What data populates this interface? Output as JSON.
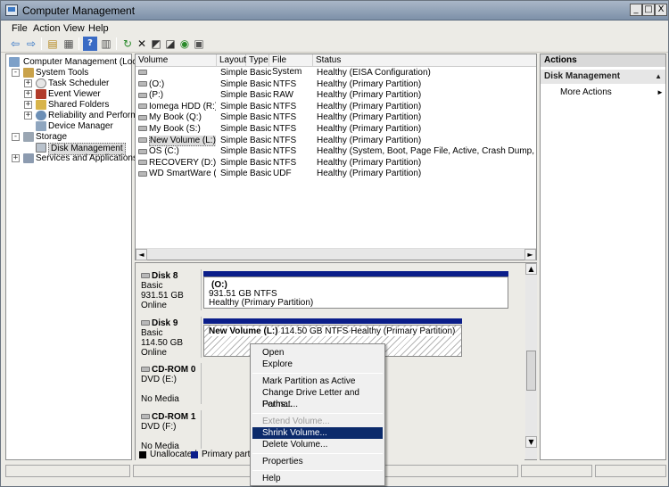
{
  "window": {
    "title": "Computer Management",
    "min": "_",
    "max": "□",
    "close": "X"
  },
  "menu": [
    "File",
    "Action",
    "View",
    "Help"
  ],
  "toolbar": {
    "icons": [
      "back-arrow-icon",
      "forward-arrow-icon",
      "up-folder-icon",
      "show-hide-tree-icon",
      "help-icon",
      "properties-icon",
      "refresh-icon",
      "delete-icon",
      "connect-icon",
      "rescan-icon",
      "settings-icon"
    ]
  },
  "tree": {
    "root": "Computer Management (Local)",
    "system_tools": "System Tools",
    "task_scheduler": "Task Scheduler",
    "event_viewer": "Event Viewer",
    "shared_folders": "Shared Folders",
    "reliability": "Reliability and Performanc",
    "device_manager": "Device Manager",
    "storage": "Storage",
    "disk_management": "Disk Management",
    "services": "Services and Applications"
  },
  "volumes": {
    "headers": [
      "Volume",
      "Layout",
      "Type",
      "File System",
      "Status"
    ],
    "rows": [
      {
        "volume": "",
        "layout": "Simple",
        "type": "Basic",
        "fs": "",
        "status": "Healthy (EISA Configuration)"
      },
      {
        "volume": "(O:)",
        "layout": "Simple",
        "type": "Basic",
        "fs": "NTFS",
        "status": "Healthy (Primary Partition)"
      },
      {
        "volume": "(P:)",
        "layout": "Simple",
        "type": "Basic",
        "fs": "RAW",
        "status": "Healthy (Primary Partition)"
      },
      {
        "volume": "Iomega HDD (R:)",
        "layout": "Simple",
        "type": "Basic",
        "fs": "NTFS",
        "status": "Healthy (Primary Partition)"
      },
      {
        "volume": "My Book (Q:)",
        "layout": "Simple",
        "type": "Basic",
        "fs": "NTFS",
        "status": "Healthy (Primary Partition)"
      },
      {
        "volume": "My Book (S:)",
        "layout": "Simple",
        "type": "Basic",
        "fs": "NTFS",
        "status": "Healthy (Primary Partition)"
      },
      {
        "volume": "New Volume (L:)",
        "layout": "Simple",
        "type": "Basic",
        "fs": "NTFS",
        "status": "Healthy (Primary Partition)"
      },
      {
        "volume": "OS (C:)",
        "layout": "Simple",
        "type": "Basic",
        "fs": "NTFS",
        "status": "Healthy (System, Boot, Page File, Active, Crash Dump, Primary Parti"
      },
      {
        "volume": "RECOVERY (D:)",
        "layout": "Simple",
        "type": "Basic",
        "fs": "NTFS",
        "status": "Healthy (Primary Partition)"
      },
      {
        "volume": "WD SmartWare (M:)",
        "layout": "Simple",
        "type": "Basic",
        "fs": "UDF",
        "status": "Healthy (Primary Partition)"
      }
    ]
  },
  "disks": [
    {
      "name": "Disk 8",
      "kind": "Basic",
      "size": "931.51 GB",
      "state": "Online",
      "part_name": "(O:)",
      "part_size": "931.51 GB NTFS",
      "part_status": "Healthy (Primary Partition)"
    },
    {
      "name": "Disk 9",
      "kind": "Basic",
      "size": "114.50 GB",
      "state": "Online",
      "part_name": "New Volume  (L:)",
      "part_size": "114.50 GB NTFS",
      "part_status": "Healthy (Primary Partition)"
    },
    {
      "name": "CD-ROM 0",
      "kind": "DVD (E:)",
      "size": "",
      "state": "No Media"
    },
    {
      "name": "CD-ROM 1",
      "kind": "DVD (F:)",
      "size": "",
      "state": "No Media"
    }
  ],
  "legend": {
    "unallocated": "Unallocated",
    "primary": "Primary partition",
    "unallocated_color": "#000000",
    "primary_color": "#0b1e8a"
  },
  "actions": {
    "title": "Actions",
    "section": "Disk Management",
    "more": "More Actions"
  },
  "context_menu": {
    "open": "Open",
    "explore": "Explore",
    "mark_active": "Mark Partition as Active",
    "change_letter": "Change Drive Letter and Paths...",
    "format": "Format...",
    "extend": "Extend Volume...",
    "shrink": "Shrink Volume...",
    "delete": "Delete Volume...",
    "properties": "Properties",
    "help": "Help"
  }
}
